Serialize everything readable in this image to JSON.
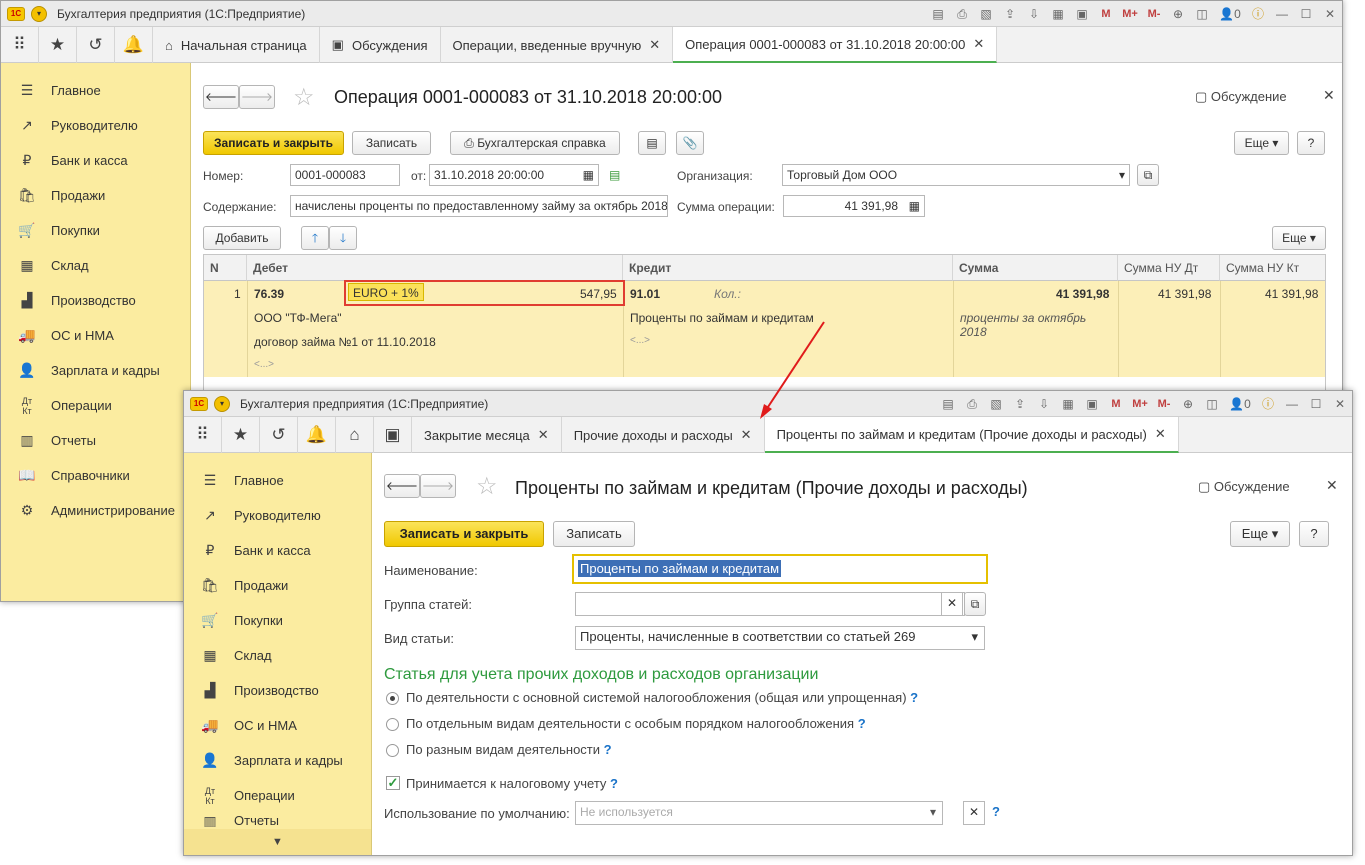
{
  "app": {
    "logo": "1С",
    "title": "Бухгалтерия предприятия  (1С:Предприятие)"
  },
  "toolbar_icons": [
    "save-icon",
    "print-icon",
    "preview-icon",
    "upload-icon",
    "download-icon",
    "calculator-icon",
    "calendar-icon",
    "M",
    "M+",
    "M-",
    "zoom-icon",
    "panel-icon",
    "user-icon",
    "info-icon"
  ],
  "win1": {
    "user_label": "0",
    "tabs": [
      {
        "label": "Начальная страница"
      },
      {
        "label": "Обсуждения"
      },
      {
        "label": "Операции, введенные вручную"
      },
      {
        "label": "Операция 0001-000083 от 31.10.2018 20:00:00"
      }
    ],
    "sidebar": [
      "Главное",
      "Руководителю",
      "Банк и касса",
      "Продажи",
      "Покупки",
      "Склад",
      "Производство",
      "ОС и НМА",
      "Зарплата и кадры",
      "Операции",
      "Отчеты",
      "Справочники",
      "Администрирование"
    ],
    "form": {
      "title": "Операция 0001-000083 от 31.10.2018 20:00:00",
      "discussion": "Обсуждение",
      "save_close": "Записать и закрыть",
      "save": "Записать",
      "reference": "Бухгалтерская справка",
      "more": "Еще",
      "help": "?",
      "number_label": "Номер:",
      "number": "0001-000083",
      "date_label": "от:",
      "date": "31.10.2018 20:00:00",
      "org_label": "Организация:",
      "org": "Торговый Дом ООО",
      "content_label": "Содержание:",
      "content": "начислены проценты по предоставленному займу за октябрь 2018",
      "sum_label": "Сумма операции:",
      "sum": "41 391,98",
      "add": "Добавить",
      "more2": "Еще"
    },
    "table": {
      "headers": [
        "N",
        "Дебет",
        "Кредит",
        "Сумма",
        "Сумма НУ Дт",
        "Сумма НУ Кт"
      ],
      "row": {
        "n": "1",
        "debit_account": "76.39",
        "currency": "EURO + 1%",
        "currency_amount": "547,95",
        "credit_account": "91.01",
        "qty_label": "Кол.:",
        "sum": "41 391,98",
        "nu_dt": "41 391,98",
        "nu_kt": "41 391,98",
        "debit_sub1": "ООО \"ТФ-Мега\"",
        "debit_sub2": "договор займа №1 от 11.10.2018",
        "debit_sub3": "<...>",
        "credit_sub1": "Проценты по займам и кредитам",
        "credit_sub2": "<...>",
        "content": "проценты за октябрь 2018"
      }
    }
  },
  "win2": {
    "user_label": "0",
    "tabs": [
      {
        "label": "Закрытие месяца"
      },
      {
        "label": "Прочие доходы и расходы"
      },
      {
        "label": "Проценты по займам и кредитам (Прочие доходы и расходы)"
      }
    ],
    "sidebar": [
      "Главное",
      "Руководителю",
      "Банк и касса",
      "Продажи",
      "Покупки",
      "Склад",
      "Производство",
      "ОС и НМА",
      "Зарплата и кадры",
      "Операции",
      "Отчеты"
    ],
    "form": {
      "title": "Проценты по займам и кредитам (Прочие доходы и расходы)",
      "discussion": "Обсуждение",
      "save_close": "Записать и закрыть",
      "save": "Записать",
      "more": "Еще",
      "help": "?",
      "name_label": "Наименование:",
      "name": "Проценты по займам и кредитам",
      "group_label": "Группа статей:",
      "group": "",
      "kind_label": "Вид статьи:",
      "kind": "Проценты, начисленные в соответствии со статьей 269",
      "section": "Статья для учета прочих доходов и расходов организации",
      "radios": [
        "По деятельности с основной системой налогообложения (общая или упрощенная)",
        "По отдельным видам деятельности с особым порядком налогообложения",
        "По разным видам деятельности"
      ],
      "checkbox": "Принимается к налоговому учету",
      "usage_label": "Использование по умолчанию:",
      "usage_placeholder": "Не используется"
    }
  },
  "colors": {
    "accent_yellow": "#f5d000",
    "sidebar": "#fbeca0",
    "highlight_red": "#e03c31",
    "arrow": "#e01b1b",
    "section_green": "#2e9a3e"
  }
}
